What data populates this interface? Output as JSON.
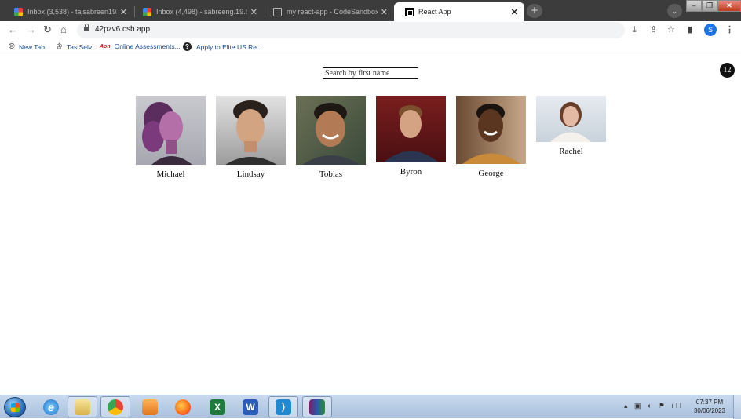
{
  "browser": {
    "tabs": [
      {
        "title": "Inbox (3,538) - tajsabreen1920@",
        "icon": "gmail-icon",
        "active": false
      },
      {
        "title": "Inbox (4,498) - sabreeng.19.becl",
        "icon": "gmail-icon",
        "active": false
      },
      {
        "title": "my react-app - CodeSandbox",
        "icon": "codesandbox-icon",
        "active": false
      },
      {
        "title": "React App",
        "icon": "react-app-icon",
        "active": true
      }
    ],
    "url": "42pzv6.csb.app",
    "profile_initial": "S",
    "bookmarks": [
      {
        "label": "New Tab",
        "icon": "globe-icon"
      },
      {
        "label": "TastSelv",
        "icon": "crown-icon"
      },
      {
        "label": "Online Assessments...",
        "icon": "aon-icon",
        "icon_text": "Aon"
      },
      {
        "label": "Apply to Elite US Re...",
        "icon": "question-icon"
      }
    ]
  },
  "app": {
    "search_placeholder": "Search by first name",
    "count": "12",
    "people": [
      {
        "name": "Michael"
      },
      {
        "name": "Lindsay"
      },
      {
        "name": "Tobias"
      },
      {
        "name": "Byron"
      },
      {
        "name": "George"
      },
      {
        "name": "Rachel"
      }
    ]
  },
  "taskbar": {
    "apps": [
      "start-icon",
      "ie-icon",
      "explorer-icon",
      "chrome-icon",
      "media-player-icon",
      "firefox-icon",
      "excel-icon",
      "word-icon",
      "vscode-icon",
      "winrar-icon"
    ],
    "time": "07:37 PM",
    "date": "30/06/2023"
  },
  "colors": {
    "tab_strip": "#3c3c3c",
    "accent": "#1a73e8",
    "badge": "#111111"
  }
}
